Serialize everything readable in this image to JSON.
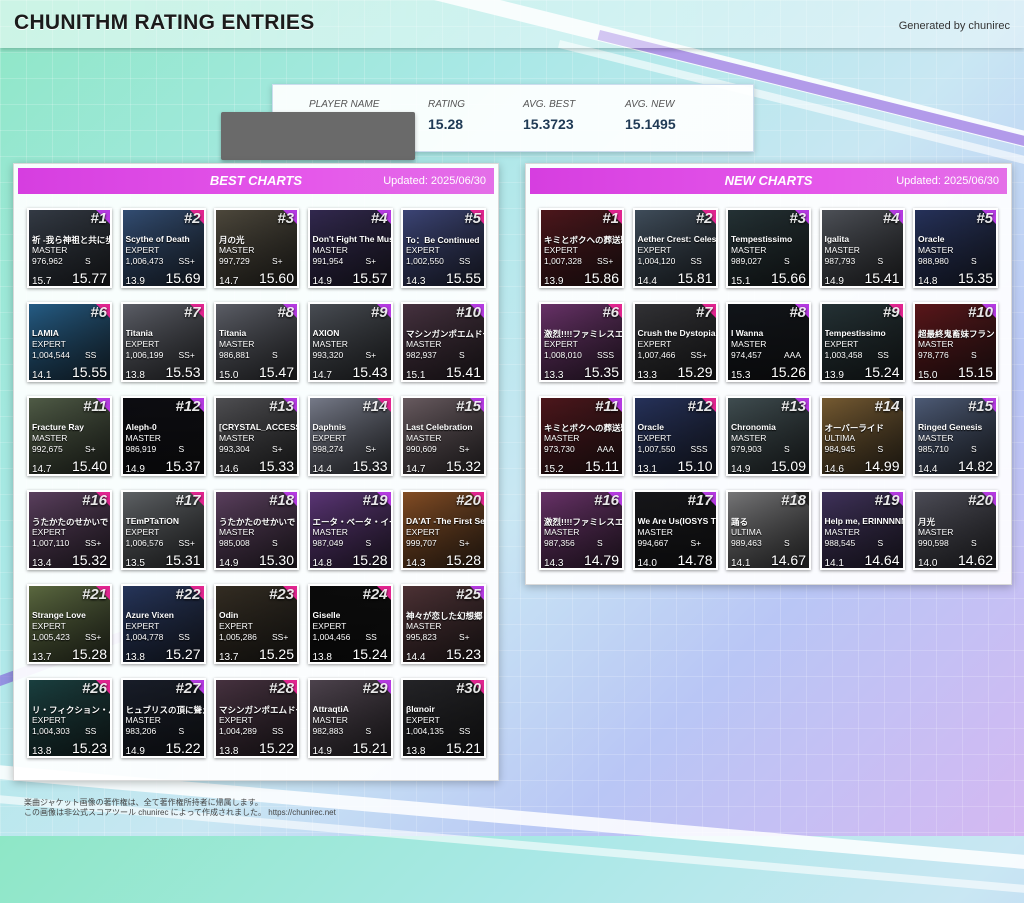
{
  "header": {
    "title": "CHUNITHM RATING ENTRIES",
    "generated_by": "Generated by chunirec"
  },
  "stats": {
    "player_label": "PLAYER NAME",
    "rating_label": "RATING",
    "rating": "15.28",
    "avg_best_label": "AVG. BEST",
    "avg_best": "15.3723",
    "avg_new_label": "AVG. NEW",
    "avg_new": "15.1495"
  },
  "best": {
    "title": "BEST CHARTS",
    "updated": "Updated: 2025/06/30",
    "entries": [
      {
        "rank": "#1",
        "title": "祈 -我ら神祖と共に歩む者なり-",
        "diff": "MASTER",
        "score": "976,962",
        "grade": "S",
        "const": "15.7",
        "rating": "15.77",
        "color": "#3c4450"
      },
      {
        "rank": "#2",
        "title": "Scythe of Death",
        "diff": "EXPERT",
        "score": "1,006,473",
        "grade": "SS+",
        "const": "13.9",
        "rating": "15.69",
        "color": "#3b5a86"
      },
      {
        "rank": "#3",
        "title": "月の光",
        "diff": "MASTER",
        "score": "997,729",
        "grade": "S+",
        "const": "14.7",
        "rating": "15.60",
        "color": "#5a5446"
      },
      {
        "rank": "#4",
        "title": "Don't Fight The Music",
        "diff": "MASTER",
        "score": "991,954",
        "grade": "S+",
        "const": "14.9",
        "rating": "15.57",
        "color": "#3a2f5c"
      },
      {
        "rank": "#5",
        "title": "To：Be Continued",
        "diff": "EXPERT",
        "score": "1,002,550",
        "grade": "SS",
        "const": "14.3",
        "rating": "15.55",
        "color": "#46508a"
      },
      {
        "rank": "#6",
        "title": "LAMIA",
        "diff": "EXPERT",
        "score": "1,004,544",
        "grade": "SS",
        "const": "14.1",
        "rating": "15.55",
        "color": "#2b6c9c"
      },
      {
        "rank": "#7",
        "title": "Titania",
        "diff": "EXPERT",
        "score": "1,006,199",
        "grade": "SS+",
        "const": "13.8",
        "rating": "15.53",
        "color": "#6b6e78"
      },
      {
        "rank": "#8",
        "title": "Titania",
        "diff": "MASTER",
        "score": "986,881",
        "grade": "S",
        "const": "15.0",
        "rating": "15.47",
        "color": "#6b6e78"
      },
      {
        "rank": "#9",
        "title": "AXION",
        "diff": "MASTER",
        "score": "993,320",
        "grade": "S+",
        "const": "14.7",
        "rating": "15.43",
        "color": "#555a62"
      },
      {
        "rank": "#10",
        "title": "マシンガンポエムドール",
        "diff": "MASTER",
        "score": "982,937",
        "grade": "S",
        "const": "15.1",
        "rating": "15.41",
        "color": "#523a4a"
      },
      {
        "rank": "#11",
        "title": "Fracture Ray",
        "diff": "MASTER",
        "score": "992,675",
        "grade": "S+",
        "const": "14.7",
        "rating": "15.40",
        "color": "#5d6b52"
      },
      {
        "rank": "#12",
        "title": "Aleph-0",
        "diff": "MASTER",
        "score": "986,919",
        "grade": "S",
        "const": "14.9",
        "rating": "15.37",
        "color": "#0e0e14"
      },
      {
        "rank": "#13",
        "title": "[CRYSTAL_ACCESS]",
        "diff": "MASTER",
        "score": "993,304",
        "grade": "S+",
        "const": "14.6",
        "rating": "15.33",
        "color": "#5c5c60"
      },
      {
        "rank": "#14",
        "title": "Daphnis",
        "diff": "EXPERT",
        "score": "998,274",
        "grade": "S+",
        "const": "14.4",
        "rating": "15.33",
        "color": "#8a8fa0"
      },
      {
        "rank": "#15",
        "title": "Last Celebration",
        "diff": "MASTER",
        "score": "990,609",
        "grade": "S+",
        "const": "14.7",
        "rating": "15.32",
        "color": "#7a6a70"
      },
      {
        "rank": "#16",
        "title": "うたかたのせかいで",
        "diff": "EXPERT",
        "score": "1,007,110",
        "grade": "SS+",
        "const": "13.4",
        "rating": "15.32",
        "color": "#6a4a6e"
      },
      {
        "rank": "#17",
        "title": "TEmPTaTiON",
        "diff": "EXPERT",
        "score": "1,006,576",
        "grade": "SS+",
        "const": "13.5",
        "rating": "15.31",
        "color": "#6e7276"
      },
      {
        "rank": "#18",
        "title": "うたかたのせかいで",
        "diff": "MASTER",
        "score": "985,008",
        "grade": "S",
        "const": "14.9",
        "rating": "15.30",
        "color": "#6a4a6e"
      },
      {
        "rank": "#19",
        "title": "エータ・ベータ・イータ",
        "diff": "MASTER",
        "score": "987,049",
        "grade": "S",
        "const": "14.8",
        "rating": "15.28",
        "color": "#6a3e8a"
      },
      {
        "rank": "#20",
        "title": "DA'AT -The First Seeker-",
        "diff": "EXPERT",
        "score": "999,707",
        "grade": "S+",
        "const": "14.3",
        "rating": "15.28",
        "color": "#9a5a2a"
      },
      {
        "rank": "#21",
        "title": "Strange Love",
        "diff": "EXPERT",
        "score": "1,005,423",
        "grade": "SS+",
        "const": "13.7",
        "rating": "15.28",
        "color": "#6a7a4a"
      },
      {
        "rank": "#22",
        "title": "Azure Vixen",
        "diff": "EXPERT",
        "score": "1,004,778",
        "grade": "SS",
        "const": "13.8",
        "rating": "15.27",
        "color": "#2c3e6a"
      },
      {
        "rank": "#23",
        "title": "Odin",
        "diff": "EXPERT",
        "score": "1,005,286",
        "grade": "SS+",
        "const": "13.7",
        "rating": "15.25",
        "color": "#3c3428"
      },
      {
        "rank": "#24",
        "title": "Giselle",
        "diff": "EXPERT",
        "score": "1,004,456",
        "grade": "SS",
        "const": "13.8",
        "rating": "15.24",
        "color": "#0c0c0c"
      },
      {
        "rank": "#25",
        "title": "神々が恋した幻想郷",
        "diff": "MASTER",
        "score": "995,823",
        "grade": "S+",
        "const": "14.4",
        "rating": "15.23",
        "color": "#5a3a3e"
      },
      {
        "rank": "#26",
        "title": "リ・フィクション・パラダイム",
        "diff": "EXPERT",
        "score": "1,004,303",
        "grade": "SS",
        "const": "13.8",
        "rating": "15.23",
        "color": "#1e4a4a"
      },
      {
        "rank": "#27",
        "title": "ヒュブリスの頂に聳える",
        "diff": "MASTER",
        "score": "983,206",
        "grade": "S",
        "const": "14.9",
        "rating": "15.22",
        "color": "#1c2230"
      },
      {
        "rank": "#28",
        "title": "マシンガンポエムドール",
        "diff": "EXPERT",
        "score": "1,004,289",
        "grade": "SS",
        "const": "13.8",
        "rating": "15.22",
        "color": "#523a4a"
      },
      {
        "rank": "#29",
        "title": "AttraqtiA",
        "diff": "MASTER",
        "score": "982,883",
        "grade": "S",
        "const": "14.9",
        "rating": "15.21",
        "color": "#5a4e5a"
      },
      {
        "rank": "#30",
        "title": "βlαnoir",
        "diff": "EXPERT",
        "score": "1,004,135",
        "grade": "SS",
        "const": "13.8",
        "rating": "15.21",
        "color": "#2a2a2e"
      }
    ]
  },
  "new": {
    "title": "NEW CHARTS",
    "updated": "Updated: 2025/06/30",
    "entries": [
      {
        "rank": "#1",
        "title": "キミとボクへの葬送歌",
        "diff": "EXPERT",
        "score": "1,007,328",
        "grade": "SS+",
        "const": "13.9",
        "rating": "15.86",
        "color": "#5a1a20"
      },
      {
        "rank": "#2",
        "title": "Aether Crest: Celestial",
        "diff": "EXPERT",
        "score": "1,004,120",
        "grade": "SS",
        "const": "14.4",
        "rating": "15.81",
        "color": "#4a5a6a"
      },
      {
        "rank": "#3",
        "title": "Tempestissimo",
        "diff": "MASTER",
        "score": "989,027",
        "grade": "S",
        "const": "15.1",
        "rating": "15.66",
        "color": "#2a3a3e"
      },
      {
        "rank": "#4",
        "title": "Igalita",
        "diff": "MASTER",
        "score": "987,793",
        "grade": "S",
        "const": "14.9",
        "rating": "15.41",
        "color": "#5a5e66"
      },
      {
        "rank": "#5",
        "title": "Oracle",
        "diff": "MASTER",
        "score": "988,980",
        "grade": "S",
        "const": "14.8",
        "rating": "15.35",
        "color": "#2c3a6a"
      },
      {
        "rank": "#6",
        "title": "激烈!!!!ファミレスエンジェル",
        "diff": "EXPERT",
        "score": "1,008,010",
        "grade": "SSS",
        "const": "13.3",
        "rating": "15.35",
        "color": "#7a3a7a"
      },
      {
        "rank": "#7",
        "title": "Crush the Dystopia",
        "diff": "EXPERT",
        "score": "1,007,466",
        "grade": "SS+",
        "const": "13.3",
        "rating": "15.29",
        "color": "#3a3a3e"
      },
      {
        "rank": "#8",
        "title": "I Wanna",
        "diff": "MASTER",
        "score": "974,457",
        "grade": "AAA",
        "const": "15.3",
        "rating": "15.26",
        "color": "#14181e"
      },
      {
        "rank": "#9",
        "title": "Tempestissimo",
        "diff": "EXPERT",
        "score": "1,003,458",
        "grade": "SS",
        "const": "13.9",
        "rating": "15.24",
        "color": "#2a3a3e"
      },
      {
        "rank": "#10",
        "title": "超最終鬼畜妹フランドール・S",
        "diff": "MASTER",
        "score": "978,776",
        "grade": "S",
        "const": "15.0",
        "rating": "15.15",
        "color": "#6a1a1e"
      },
      {
        "rank": "#11",
        "title": "キミとボクへの葬送歌",
        "diff": "MASTER",
        "score": "973,730",
        "grade": "AAA",
        "const": "15.2",
        "rating": "15.11",
        "color": "#5a1a20"
      },
      {
        "rank": "#12",
        "title": "Oracle",
        "diff": "EXPERT",
        "score": "1,007,550",
        "grade": "SSS",
        "const": "13.1",
        "rating": "15.10",
        "color": "#2c3a6a"
      },
      {
        "rank": "#13",
        "title": "Chronomia",
        "diff": "MASTER",
        "score": "979,903",
        "grade": "S",
        "const": "14.9",
        "rating": "15.09",
        "color": "#4a5a5e"
      },
      {
        "rank": "#14",
        "title": "オーバーライド",
        "diff": "ULTIMA",
        "score": "984,945",
        "grade": "S",
        "const": "14.6",
        "rating": "14.99",
        "color": "#8a6a3a"
      },
      {
        "rank": "#15",
        "title": "Ringed Genesis",
        "diff": "MASTER",
        "score": "985,710",
        "grade": "S",
        "const": "14.4",
        "rating": "14.82",
        "color": "#5a6a8a"
      },
      {
        "rank": "#16",
        "title": "激烈!!!!ファミレスエンジェル",
        "diff": "MASTER",
        "score": "987,356",
        "grade": "S",
        "const": "14.3",
        "rating": "14.79",
        "color": "#7a3a7a"
      },
      {
        "rank": "#17",
        "title": "We Are Us(IOSYS TRAX)",
        "diff": "MASTER",
        "score": "994,667",
        "grade": "S+",
        "const": "14.0",
        "rating": "14.78",
        "color": "#1a1a1e"
      },
      {
        "rank": "#18",
        "title": "踊る",
        "diff": "ULTIMA",
        "score": "989,463",
        "grade": "S",
        "const": "14.1",
        "rating": "14.67",
        "color": "#8a8a8c"
      },
      {
        "rank": "#19",
        "title": "Help me, ERINNNNNN!!",
        "diff": "MASTER",
        "score": "988,545",
        "grade": "S",
        "const": "14.1",
        "rating": "14.64",
        "color": "#4a3a6a"
      },
      {
        "rank": "#20",
        "title": "月光",
        "diff": "MASTER",
        "score": "990,598",
        "grade": "S",
        "const": "14.0",
        "rating": "14.62",
        "color": "#5a5a66"
      }
    ]
  },
  "footer": {
    "line1": "楽曲ジャケット画像の著作権は、全て著作権所持者に帰属します。",
    "line2": "この画像は非公式スコアツール chunirec によって作成されました。 https://chunirec.net"
  }
}
